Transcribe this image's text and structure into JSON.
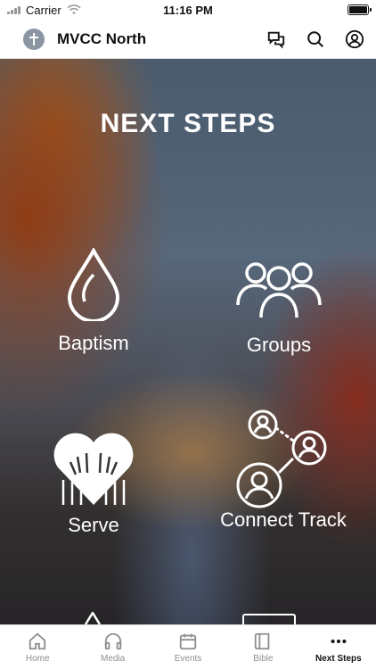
{
  "status_bar": {
    "carrier": "Carrier",
    "time": "11:16 PM"
  },
  "header": {
    "title": "MVCC North"
  },
  "hero": {
    "title": "NEXT STEPS"
  },
  "tiles": [
    {
      "label": "Baptism",
      "icon": "water-drop-icon"
    },
    {
      "label": "Groups",
      "icon": "people-group-icon"
    },
    {
      "label": "Serve",
      "icon": "raised-hands-heart-icon"
    },
    {
      "label": "Connect Track",
      "icon": "connected-users-icon"
    }
  ],
  "tab_bar": {
    "items": [
      {
        "label": "Home",
        "icon": "home-icon"
      },
      {
        "label": "Media",
        "icon": "headphones-icon"
      },
      {
        "label": "Events",
        "icon": "calendar-icon"
      },
      {
        "label": "Bible",
        "icon": "book-icon"
      },
      {
        "label": "Next Steps",
        "icon": "more-dots-icon"
      }
    ],
    "active": "Next Steps"
  },
  "colors": {
    "active_tab": "#111111",
    "inactive_tab": "#8e8e8e",
    "hero_text": "#ffffff"
  }
}
